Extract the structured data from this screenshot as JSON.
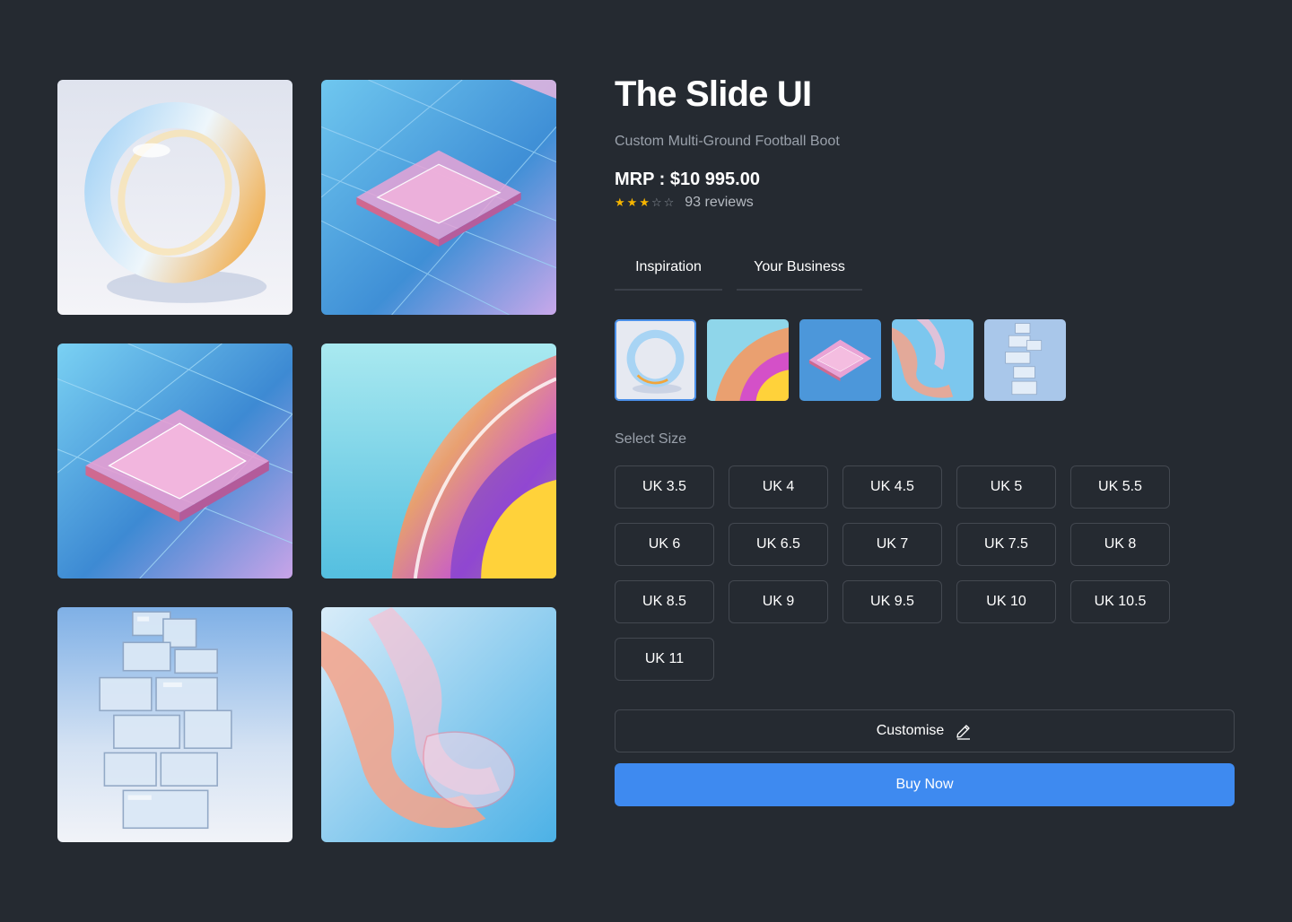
{
  "product": {
    "title": "The Slide UI",
    "subtitle": "Custom Multi-Ground Football Boot",
    "price": "MRP : $10 995.00",
    "rating": 3,
    "rating_max": 5,
    "reviews": "93 reviews"
  },
  "tabs": [
    {
      "label": "Inspiration"
    },
    {
      "label": "Your Business"
    }
  ],
  "gallery": [
    {
      "icon": "glass-ring-image"
    },
    {
      "icon": "circuit-chip-image"
    },
    {
      "icon": "circuit-chip-image"
    },
    {
      "icon": "iridescent-wave-image"
    },
    {
      "icon": "glass-cubes-tower-image"
    },
    {
      "icon": "translucent-ribbon-image"
    }
  ],
  "thumbnails": {
    "selected_index": 0,
    "items": [
      "glass-ring-image",
      "iridescent-wave-image",
      "circuit-chip-image",
      "translucent-ribbon-image",
      "glass-cubes-tower-image"
    ]
  },
  "sizes": {
    "label": "Select Size",
    "options": [
      "UK 3.5",
      "UK 4",
      "UK 4.5",
      "UK 5",
      "UK 5.5",
      "UK 6",
      "UK 6.5",
      "UK 7",
      "UK 7.5",
      "UK 8",
      "UK 8.5",
      "UK 9",
      "UK 9.5",
      "UK 10",
      "UK 10.5",
      "UK 11"
    ]
  },
  "actions": {
    "customise_label": "Customise",
    "customise_icon": "pencil-icon",
    "buy_label": "Buy Now"
  },
  "colors": {
    "background": "#252a31",
    "accent": "#3e8af0",
    "star": "#f5b400"
  }
}
